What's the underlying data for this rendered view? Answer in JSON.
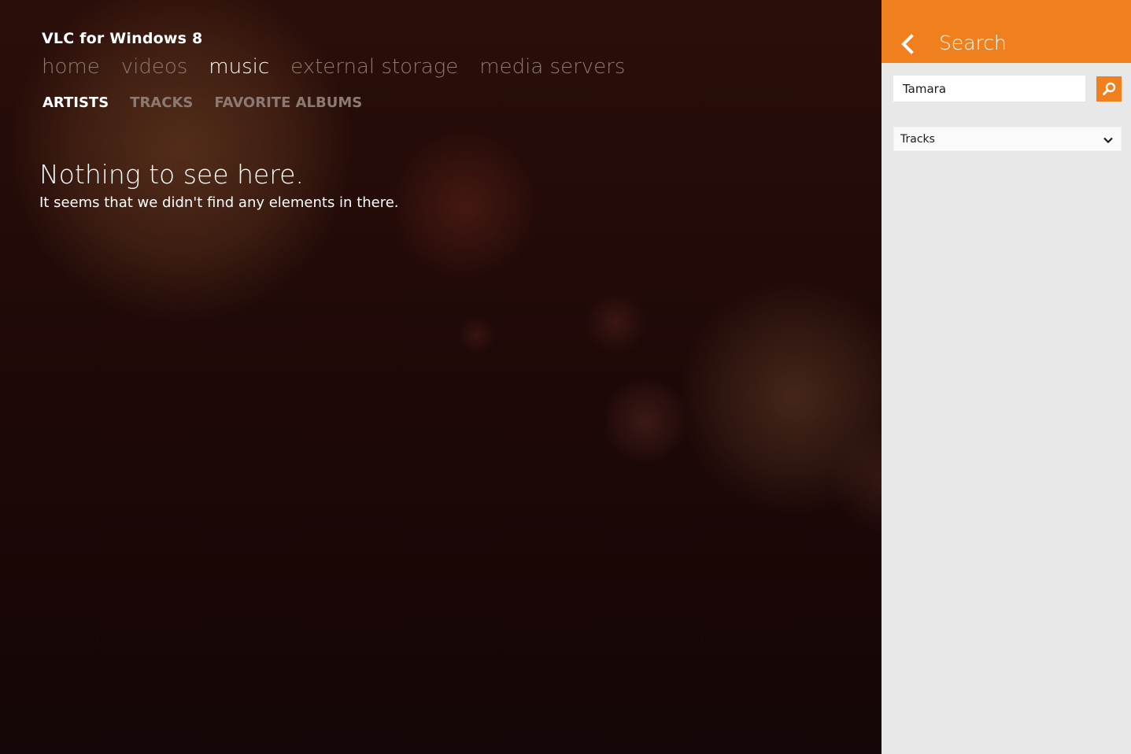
{
  "app": {
    "title": "VLC for Windows 8",
    "nav": [
      {
        "label": "home",
        "active": false
      },
      {
        "label": "videos",
        "active": false
      },
      {
        "label": "music",
        "active": true
      },
      {
        "label": "external storage",
        "active": false
      },
      {
        "label": "media servers",
        "active": false
      }
    ],
    "subnav": [
      {
        "label": "ARTISTS",
        "active": true
      },
      {
        "label": "TRACKS",
        "active": false
      },
      {
        "label": "FAVORITE ALBUMS",
        "active": false
      }
    ],
    "empty_state": {
      "title": "Nothing to see here.",
      "message": "It seems that we didn't find any elements in there."
    }
  },
  "search_pane": {
    "title": "Search",
    "query": "Tamara",
    "filter": {
      "selected": "Tracks"
    },
    "icons": {
      "back": "back-arrow-icon",
      "search": "magnifier-icon",
      "dropdown": "chevron-down-icon"
    },
    "accent_color": "#f07f1d"
  }
}
